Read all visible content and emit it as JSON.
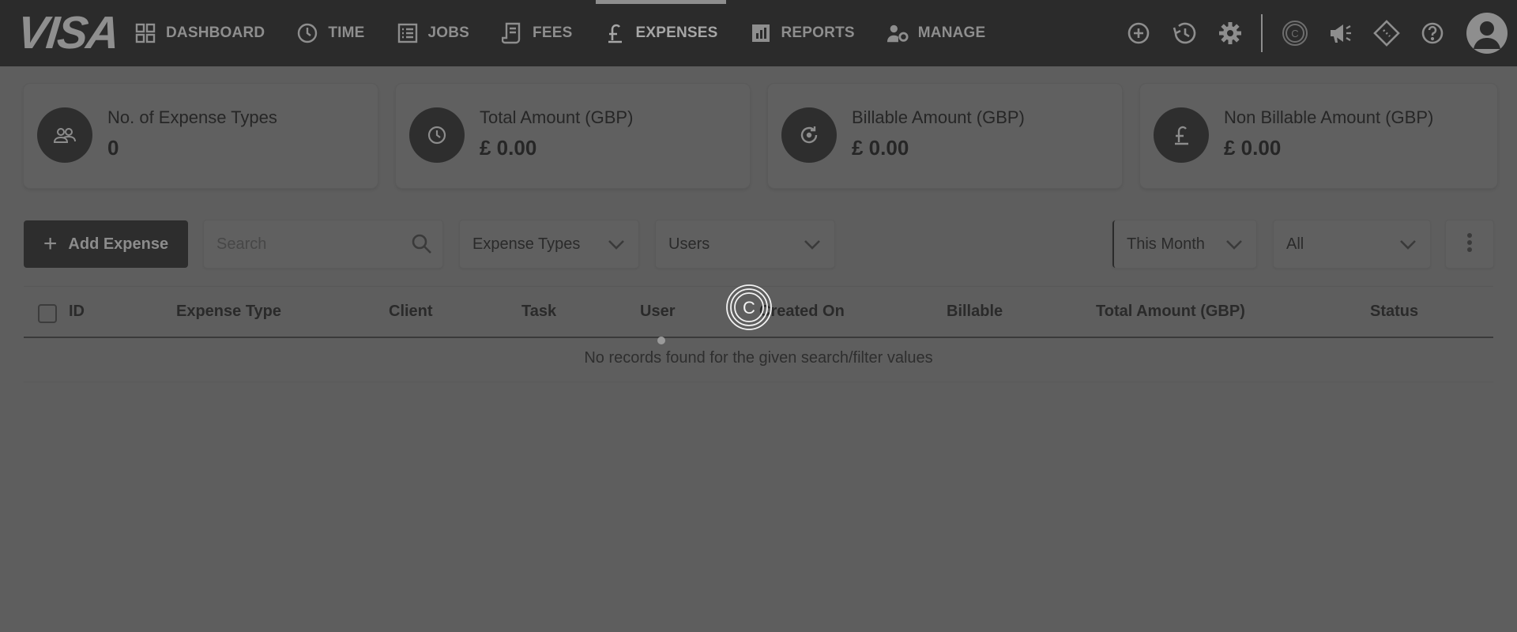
{
  "brand": {
    "logo": "VISA"
  },
  "nav": {
    "items": [
      {
        "label": "DASHBOARD",
        "icon": "dashboard-grid-icon",
        "active": false
      },
      {
        "label": "TIME",
        "icon": "clock-icon",
        "active": false
      },
      {
        "label": "JOBS",
        "icon": "list-icon",
        "active": false
      },
      {
        "label": "FEES",
        "icon": "receipt-icon",
        "active": false
      },
      {
        "label": "EXPENSES",
        "icon": "pound-icon",
        "active": true
      },
      {
        "label": "REPORTS",
        "icon": "bar-chart-icon",
        "active": false
      },
      {
        "label": "MANAGE",
        "icon": "user-gear-icon",
        "active": false
      }
    ],
    "tools": [
      "add-circle-icon",
      "history-icon",
      "settings-gear-icon",
      "c-logo-icon",
      "megaphone-icon",
      "ticket-icon",
      "help-icon"
    ]
  },
  "stats": [
    {
      "label": "No. of Expense Types",
      "value": "0",
      "icon": "group-icon"
    },
    {
      "label": "Total Amount (GBP)",
      "value": "£ 0.00",
      "icon": "clock-icon"
    },
    {
      "label": "Billable Amount (GBP)",
      "value": "£ 0.00",
      "icon": "refresh-icon"
    },
    {
      "label": "Non Billable Amount (GBP)",
      "value": "£ 0.00",
      "icon": "pound-icon"
    }
  ],
  "toolbar": {
    "add_label": "Add Expense",
    "search_placeholder": "Search",
    "expense_types": "Expense Types",
    "users": "Users",
    "period": "This Month",
    "status": "All"
  },
  "table": {
    "headers": [
      "ID",
      "Expense Type",
      "Client",
      "Task",
      "User",
      "Created On",
      "Billable",
      "Total Amount (GBP)",
      "Status"
    ],
    "empty_message": "No records found for the given search/filter values"
  },
  "loader": {
    "glyph": "C"
  }
}
